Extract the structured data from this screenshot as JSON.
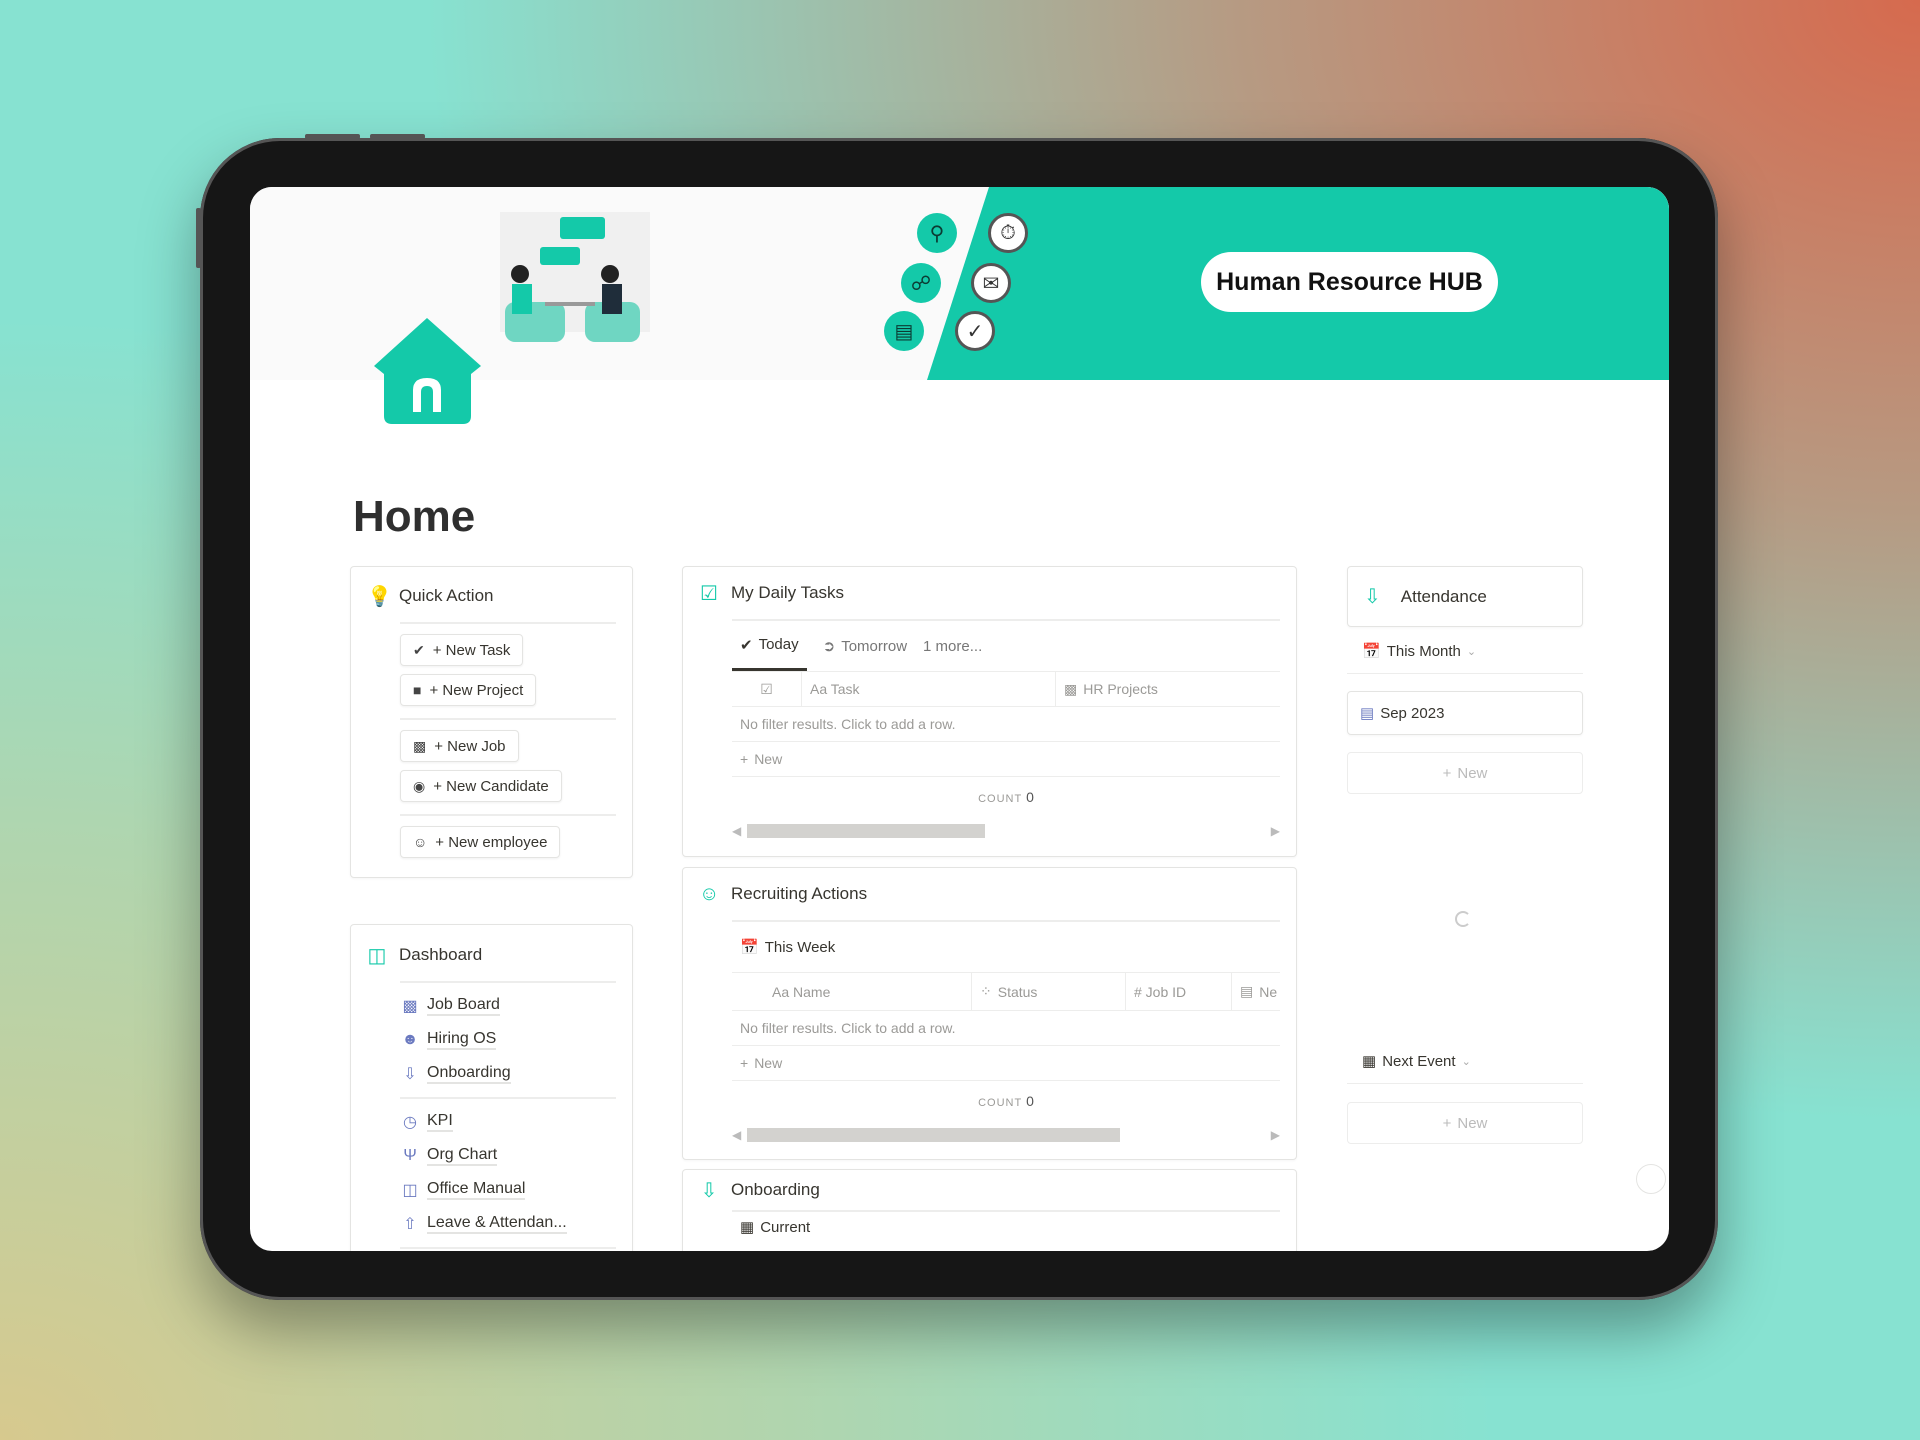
{
  "banner": {
    "title": "Human Resource HUB"
  },
  "page": {
    "title": "Home"
  },
  "quick_action": {
    "title": "Quick Action",
    "icon": "lightbulb-icon",
    "buttons": [
      {
        "label": "+ New Task",
        "icon": "check-circle-icon"
      },
      {
        "label": "+ New Project",
        "icon": "folder-icon"
      },
      {
        "label": "+ New Job",
        "icon": "briefcase-icon"
      },
      {
        "label": "+ New Candidate",
        "icon": "person-circle-icon"
      },
      {
        "label": "+ New employee",
        "icon": "user-circle-icon"
      }
    ]
  },
  "daily_tasks": {
    "title": "My Daily Tasks",
    "tabs": [
      "Today",
      "Tomorrow",
      "1 more..."
    ],
    "columns": [
      "Aa Task",
      "HR Projects"
    ],
    "empty": "No filter results. Click to add a row.",
    "new": "New",
    "count_label": "COUNT",
    "count": "0",
    "scroll_fraction": 0.3
  },
  "recruiting": {
    "title": "Recruiting Actions",
    "view": "This Week",
    "columns": [
      "Aa Name",
      "Status",
      "# Job ID",
      "Ne"
    ],
    "empty": "No filter results. Click to add a row.",
    "new": "New",
    "count_label": "COUNT",
    "count": "0"
  },
  "onboarding": {
    "title": "Onboarding",
    "view": "Current"
  },
  "dashboard": {
    "title": "Dashboard",
    "links": [
      {
        "label": "Job Board",
        "icon": "briefcase-icon"
      },
      {
        "label": "Hiring OS",
        "icon": "add-person-icon"
      },
      {
        "label": "Onboarding",
        "icon": "onboarding-icon"
      },
      {
        "label": "KPI",
        "icon": "gauge-icon"
      },
      {
        "label": "Org Chart",
        "icon": "org-chart-icon"
      },
      {
        "label": "Office Manual",
        "icon": "book-icon"
      },
      {
        "label": "Leave & Attendan...",
        "icon": "leave-icon"
      }
    ]
  },
  "attendance": {
    "title": "Attendance",
    "view": "This Month",
    "month": "Sep 2023",
    "new": "New",
    "next_view": "Next Event",
    "next_new": "New"
  },
  "colors": {
    "accent": "#14c9a9",
    "text": "#37352f"
  }
}
